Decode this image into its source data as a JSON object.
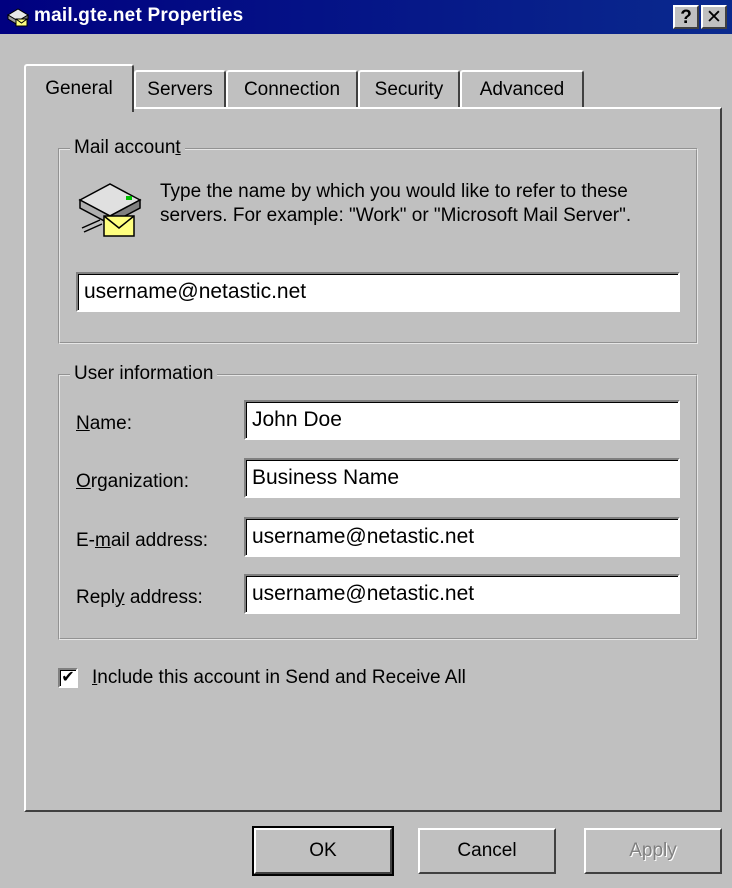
{
  "window": {
    "title": "mail.gte.net Properties",
    "help_label": "?",
    "close_label": "✕"
  },
  "tabs": [
    {
      "label": "General",
      "active": true
    },
    {
      "label": "Servers",
      "active": false
    },
    {
      "label": "Connection",
      "active": false
    },
    {
      "label": "Security",
      "active": false
    },
    {
      "label": "Advanced",
      "active": false
    }
  ],
  "mail_account": {
    "group_title_prefix": "Mail accoun",
    "group_title_mnemonic": "t",
    "description": "Type the name by which you would like to refer to these servers.  For example: \"Work\" or \"Microsoft Mail Server\".",
    "value": "username@netastic.net"
  },
  "user_info": {
    "group_title": "User information",
    "fields": [
      {
        "mnemonic": "N",
        "label_rest": "ame:",
        "value": "John Doe"
      },
      {
        "mnemonic": "O",
        "label_rest": "rganization:",
        "value": "Business Name"
      },
      {
        "label_pre": "E-",
        "mnemonic": "m",
        "label_rest": "ail address:",
        "value": "username@netastic.net"
      },
      {
        "label_pre": "Repl",
        "mnemonic": "y",
        "label_rest": " address:",
        "value": "username@netastic.net"
      }
    ]
  },
  "include_checkbox": {
    "checked": true,
    "mark": "✔",
    "mnemonic": "I",
    "label_rest": "nclude this account in Send and Receive All"
  },
  "buttons": {
    "ok": "OK",
    "cancel": "Cancel",
    "apply": "Apply"
  }
}
